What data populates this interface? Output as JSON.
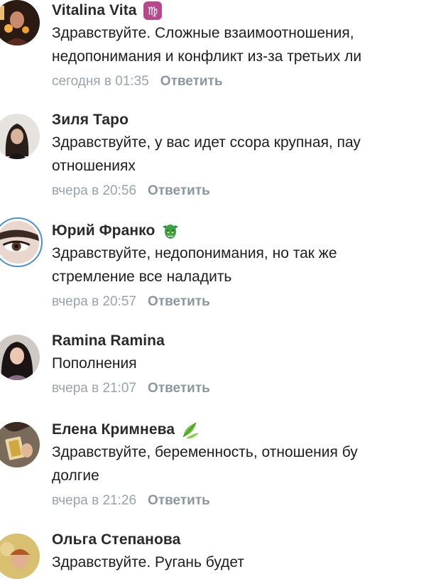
{
  "comments": [
    {
      "author": "Vitalina Vita",
      "emoji": "virgo-zodiac-emoji",
      "lines": [
        "Здравствуйте. Сложные взаимоотношения,",
        "недопонимания и конфликт из-за третьих ли"
      ],
      "time": "сегодня в 01:35",
      "reply": "Ответить"
    },
    {
      "author": "Зиля Таро",
      "emoji": "",
      "lines": [
        "Здравствуйте, у вас идет ссора крупная, пау",
        "отношениях"
      ],
      "time": "вчера в 20:56",
      "reply": "Ответить"
    },
    {
      "author": "Юрий Франко",
      "emoji": "goblin-face-emoji",
      "lines": [
        "Здравствуйте, недопонимания, но так  же",
        "стремление все наладить"
      ],
      "time": "вчера в 20:57",
      "reply": "Ответить"
    },
    {
      "author": "Ramina Ramina",
      "emoji": "",
      "lines": [
        "Пополнения"
      ],
      "time": "вчера в 21:07",
      "reply": "Ответить"
    },
    {
      "author": "Елена Кримнева",
      "emoji": "leaves-emoji",
      "lines": [
        "Здравствуйте, беременность, отношения бу",
        "долгие"
      ],
      "time": "вчера в 21:26",
      "reply": "Ответить"
    },
    {
      "author": "Ольга Степанова",
      "emoji": "",
      "lines": [
        "Здравствуйте. Ругань будет"
      ],
      "time": "",
      "reply": ""
    }
  ],
  "colors": {
    "name": "#2a2a2a",
    "text": "#1e1e1e",
    "time": "#9aa3ad",
    "reply": "#8a96a3",
    "avatar_ring": "#4a8fd9"
  }
}
